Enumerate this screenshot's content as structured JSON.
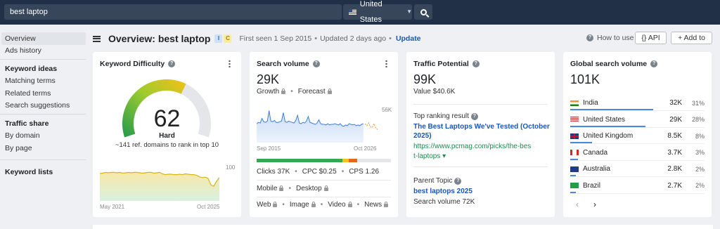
{
  "topbar": {
    "query": "best laptop",
    "country": "United States"
  },
  "sidebar": {
    "overview": "Overview",
    "ads_history": "Ads history",
    "keyword_ideas": "Keyword ideas",
    "matching_terms": "Matching terms",
    "related_terms": "Related terms",
    "search_suggestions": "Search suggestions",
    "traffic_share": "Traffic share",
    "by_domain": "By domain",
    "by_page": "By page",
    "keyword_lists": "Keyword lists"
  },
  "header": {
    "title": "Overview: best laptop",
    "badge_i": "I",
    "badge_c": "C",
    "first_seen": "First seen 1 Sep 2015",
    "updated": "Updated 2 days ago",
    "update_link": "Update",
    "how_to_use": "How to use",
    "api": "{} API",
    "add_to": "+ Add to"
  },
  "kd": {
    "title": "Keyword Difficulty",
    "value": "62",
    "label": "Hard",
    "note": "~141 ref. domains to rank in top 10",
    "chart_max": "100",
    "x_start": "May 2021",
    "x_end": "Oct 2025",
    "gauge_level": 0.62,
    "colors": {
      "green": "#2f9e4a",
      "yellow": "#e8c21a",
      "gray": "#e4e6e9"
    }
  },
  "sv": {
    "title": "Search volume",
    "value": "29K",
    "growth": "Growth",
    "forecast": "Forecast",
    "chart_max": "56K",
    "x_start": "Sep 2015",
    "x_end": "Oct 2026",
    "clicks": "Clicks 37K",
    "cpc": "CPC $0.25",
    "cps": "CPS 1.26",
    "mobile": "Mobile",
    "desktop": "Desktop",
    "web": "Web",
    "image": "Image",
    "video": "Video",
    "news": "News"
  },
  "tp": {
    "title": "Traffic Potential",
    "value": "99K",
    "value_sub": "Value $40.6K",
    "top_result_label": "Top ranking result",
    "top_result_title": "The Best Laptops We've Tested (October 2025)",
    "top_result_url": "https://www.pcmag.com/picks/the-best-laptops ▾",
    "parent_topic_label": "Parent Topic",
    "parent_topic": "best laptops 2025",
    "parent_volume": "Search volume 72K"
  },
  "gsv": {
    "title": "Global search volume",
    "value": "101K",
    "rows": [
      {
        "name": "India",
        "vol": "32K",
        "pct": "31%",
        "share": 0.31,
        "flag": "india-flag-icon"
      },
      {
        "name": "United States",
        "vol": "29K",
        "pct": "28%",
        "share": 0.28,
        "flag": "us-flag-icon"
      },
      {
        "name": "United Kingdom",
        "vol": "8.5K",
        "pct": "8%",
        "share": 0.08,
        "flag": "uk-flag-icon"
      },
      {
        "name": "Canada",
        "vol": "3.7K",
        "pct": "3%",
        "share": 0.03,
        "flag": "canada-flag-icon"
      },
      {
        "name": "Australia",
        "vol": "2.8K",
        "pct": "2%",
        "share": 0.02,
        "flag": "australia-flag-icon"
      },
      {
        "name": "Brazil",
        "vol": "2.7K",
        "pct": "2%",
        "share": 0.02,
        "flag": "brazil-flag-icon"
      }
    ],
    "prev": "‹",
    "next": "›"
  },
  "chart_data": [
    {
      "type": "area",
      "title": "",
      "x_range": [
        "May 2021",
        "Oct 2025"
      ],
      "ylim": [
        0,
        100
      ],
      "series": [
        {
          "values": [
            75,
            76,
            78,
            77,
            78,
            78,
            77,
            78,
            76,
            77,
            78,
            77,
            78,
            78,
            77,
            76,
            77,
            78,
            78,
            76,
            77,
            78,
            74,
            72,
            73,
            73,
            72,
            72,
            73,
            72,
            74,
            73,
            72,
            72,
            70,
            66,
            64,
            65,
            62,
            44,
            40,
            54,
            64
          ]
        }
      ]
    },
    {
      "type": "area",
      "title": "",
      "x_range": [
        "Sep 2015",
        "Oct 2026"
      ],
      "ylim": [
        0,
        56000
      ],
      "series": [
        {
          "values": [
            29000,
            31000,
            30000,
            37000,
            32000,
            31000,
            33000,
            49000,
            33000,
            32000,
            34000,
            31000,
            31000,
            32000,
            33000,
            46000,
            32000,
            31000,
            33000,
            32000,
            31000,
            30000,
            34000,
            42000,
            30000,
            29000,
            31000,
            30000,
            33000,
            40000,
            31000,
            30000,
            29000,
            28000,
            30000,
            35000,
            29000,
            28000,
            28000,
            27000,
            29000,
            27000,
            28000,
            28000,
            29000,
            28000,
            27000,
            29000,
            26000,
            25000,
            27000,
            26000,
            29000,
            28000,
            27000,
            28000,
            26000,
            27000,
            26000,
            28000,
            29000
          ]
        },
        {
          "values": [
            29000,
            26000,
            30000,
            24000,
            23000,
            29000,
            22000,
            20000
          ]
        }
      ]
    }
  ]
}
